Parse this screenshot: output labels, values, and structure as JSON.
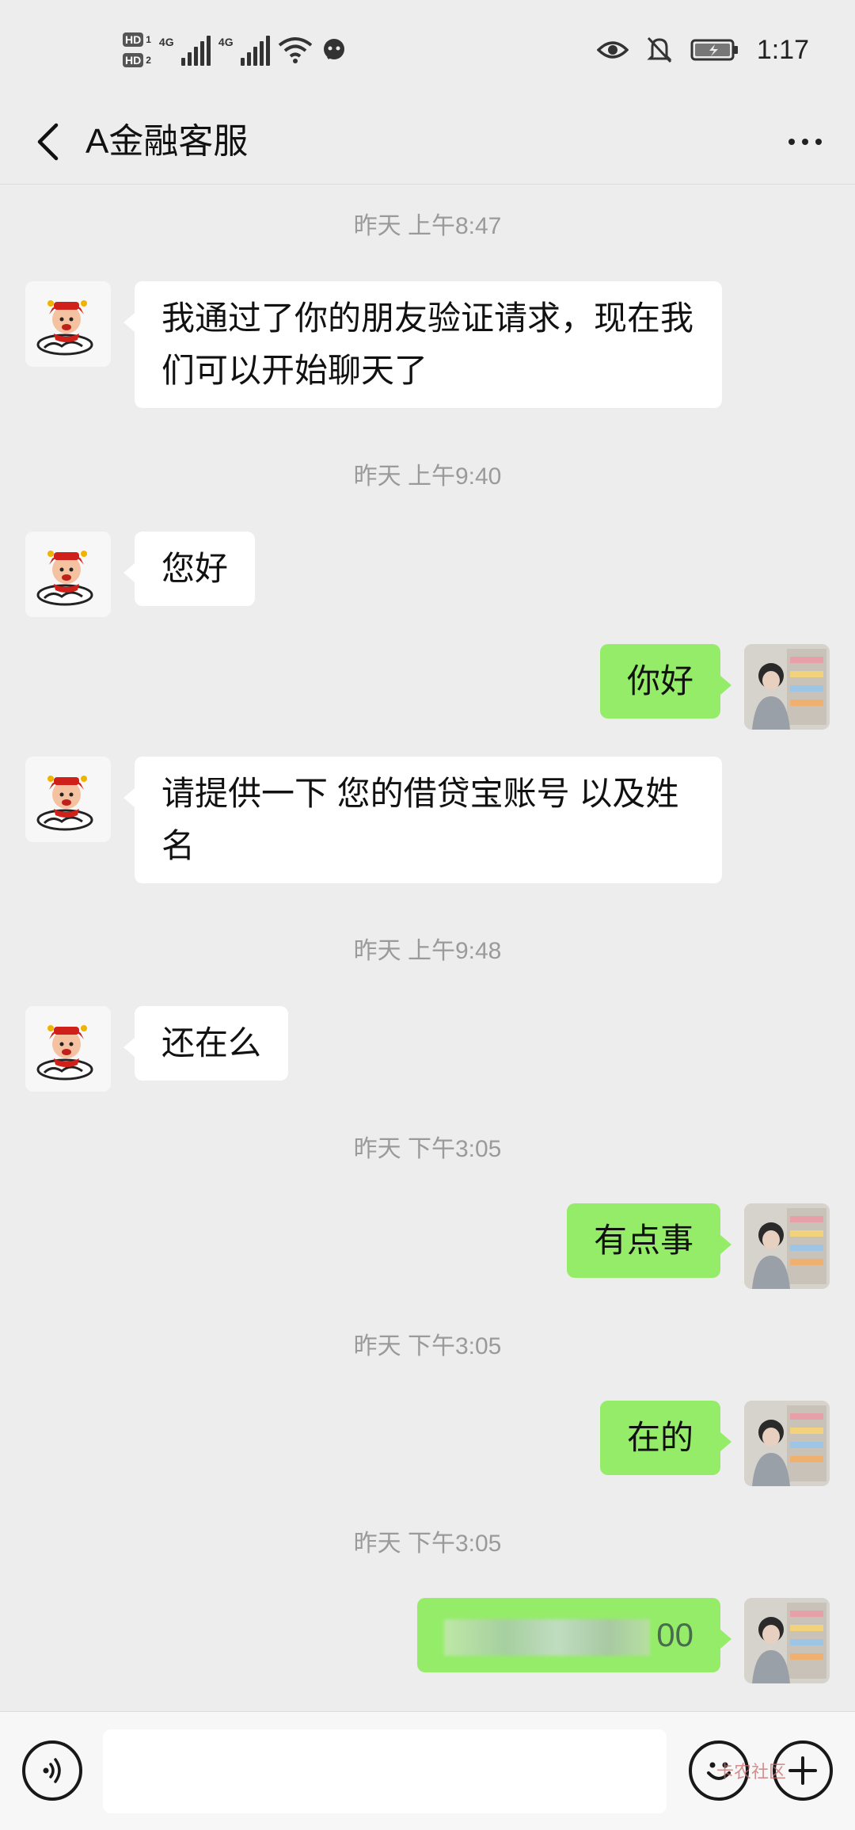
{
  "status_bar": {
    "sim1_label": "HD",
    "sim1_num": "1",
    "sim2_label": "HD",
    "sim2_num": "2",
    "network1": "4G",
    "network2": "4G",
    "time": "1:17"
  },
  "header": {
    "title": "A金融客服"
  },
  "messages": [
    {
      "type": "timestamp",
      "text": "昨天 上午8:47"
    },
    {
      "type": "received",
      "text": "我通过了你的朋友验证请求，现在我们可以开始聊天了"
    },
    {
      "type": "timestamp",
      "text": "昨天 上午9:40"
    },
    {
      "type": "received",
      "text": "您好"
    },
    {
      "type": "sent",
      "text": "你好"
    },
    {
      "type": "received",
      "text": "请提供一下 您的借贷宝账号 以及姓名"
    },
    {
      "type": "timestamp",
      "text": "昨天 上午9:48"
    },
    {
      "type": "received",
      "text": "还在么"
    },
    {
      "type": "timestamp",
      "text": "昨天 下午3:05"
    },
    {
      "type": "sent",
      "text": "有点事"
    },
    {
      "type": "timestamp",
      "text": "昨天 下午3:05"
    },
    {
      "type": "sent",
      "text": "在的"
    },
    {
      "type": "timestamp",
      "text": "昨天 下午3:05"
    },
    {
      "type": "sent",
      "text": "00",
      "redacted": true
    }
  ],
  "input": {
    "value": ""
  },
  "watermark": "卡农社区"
}
